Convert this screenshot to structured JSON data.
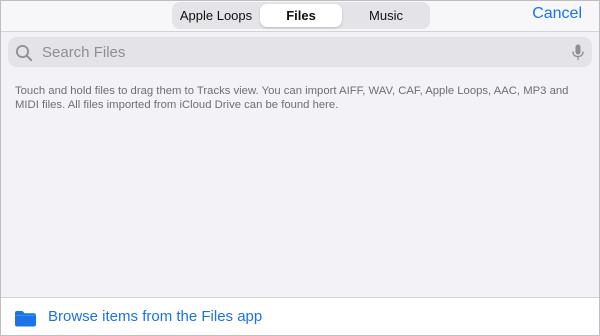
{
  "segments": {
    "apple_loops": "Apple Loops",
    "files": "Files",
    "music": "Music"
  },
  "cancel_label": "Cancel",
  "search": {
    "placeholder": "Search Files",
    "value": ""
  },
  "info_text": "Touch and hold files to drag them to Tracks view. You can import AIFF, WAV, CAF, Apple Loops, AAC, MP3 and MIDI files. All files imported from iCloud Drive can be found here.",
  "browse_label": "Browse items from the Files app",
  "colors": {
    "accent": "#1a73e8",
    "background": "#f2f2f7"
  },
  "icons": {
    "search": "magnifying-glass-icon",
    "mic": "microphone-icon",
    "folder": "folder-icon"
  }
}
